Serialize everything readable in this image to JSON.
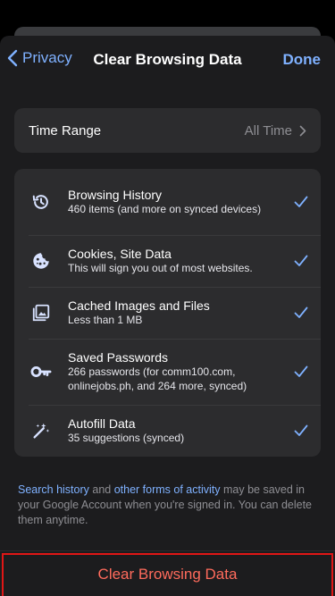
{
  "nav": {
    "back_label": "Privacy",
    "title": "Clear Browsing Data",
    "done_label": "Done"
  },
  "time_range": {
    "label": "Time Range",
    "value": "All Time"
  },
  "items": [
    {
      "icon": "history-icon",
      "title": "Browsing History",
      "subtitle": "460 items (and more on synced devices)",
      "checked": true
    },
    {
      "icon": "cookie-icon",
      "title": "Cookies, Site Data",
      "subtitle": "This will sign you out of most websites.",
      "checked": true
    },
    {
      "icon": "image-icon",
      "title": "Cached Images and Files",
      "subtitle": "Less than 1 MB",
      "checked": true
    },
    {
      "icon": "key-icon",
      "title": "Saved Passwords",
      "subtitle": "266 passwords (for comm100.com, onlinejobs.ph, and 264 more, synced)",
      "checked": true
    },
    {
      "icon": "magic-wand-icon",
      "title": "Autofill Data",
      "subtitle": "35 suggestions (synced)",
      "checked": true
    }
  ],
  "footer": {
    "link1": "Search history",
    "text1": " and ",
    "link2": "other forms of activity",
    "text2": " may be saved in your Google Account when you're signed in. You can delete them anytime."
  },
  "clear_button": {
    "label": "Clear Browsing Data"
  },
  "colors": {
    "accent": "#7fb1ff",
    "destructive": "#ff6b5c",
    "background": "#1c1c1e",
    "card": "#2c2c2e"
  }
}
